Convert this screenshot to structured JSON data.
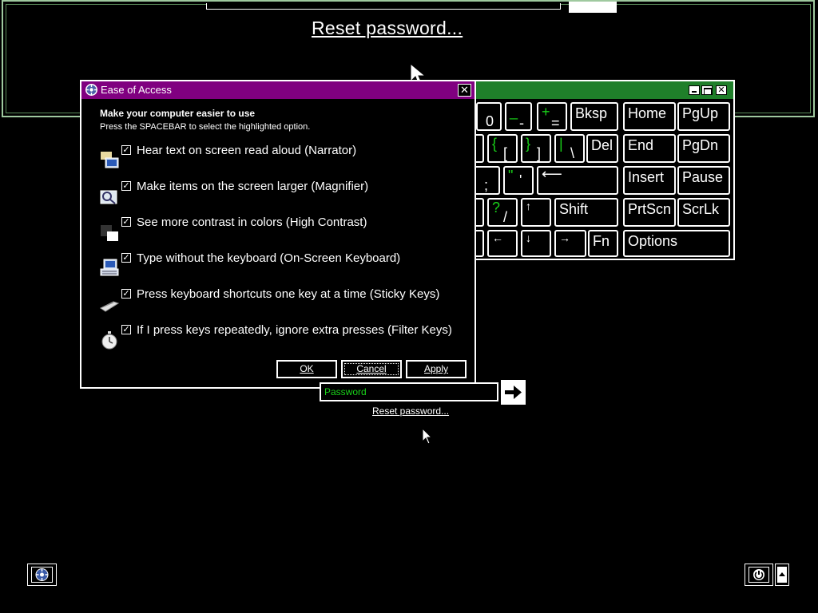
{
  "magnifier": {
    "reset_label": "Reset password..."
  },
  "keyboard": {
    "keys": {
      "zero": "0",
      "minus_top": "_",
      "minus": "-",
      "plus_top": "+",
      "equals": "=",
      "bksp": "Bksp",
      "home": "Home",
      "pgup": "PgUp",
      "brace_l_top": "{",
      "bracket_l": "[",
      "brace_r_top": "}",
      "bracket_r": "]",
      "pipe_top": "|",
      "backslash": "\\",
      "del": "Del",
      "end": "End",
      "pgdn": "PgDn",
      "semicolon": ";",
      "quote_top": "\"",
      "quote": "'",
      "enter": "⟵",
      "insert": "Insert",
      "pause": "Pause",
      "question_top": "?",
      "slash": "/",
      "up": "↑",
      "shift": "Shift",
      "prtscn": "PrtScn",
      "scrlk": "ScrLk",
      "left": "←",
      "down": "↓",
      "right": "→",
      "fn": "Fn",
      "options": "Options"
    }
  },
  "dialog": {
    "title": "Ease of Access",
    "close": "✕",
    "heading": "Make your computer easier to use",
    "subtitle": "Press the SPACEBAR to select the highlighted option.",
    "options": [
      {
        "label": "Hear text on screen read aloud (Narrator)",
        "checked": "✓",
        "icon": "narrator-icon"
      },
      {
        "label": "Make items on the screen larger (Magnifier)",
        "checked": "✓",
        "icon": "magnifier-icon"
      },
      {
        "label": "See more contrast in colors (High Contrast)",
        "checked": "✓",
        "icon": "high-contrast-icon"
      },
      {
        "label": "Type without the keyboard (On-Screen Keyboard)",
        "checked": "✓",
        "icon": "keyboard-icon"
      },
      {
        "label": "Press keyboard shortcuts one key at a time (Sticky Keys)",
        "checked": "✓",
        "icon": "sticky-keys-icon"
      },
      {
        "label": "If I press keys repeatedly, ignore extra presses (Filter Keys)",
        "checked": "✓",
        "icon": "filter-keys-icon"
      }
    ],
    "ok": "OK",
    "cancel": "Cancel",
    "apply": "Apply"
  },
  "login": {
    "password_placeholder": "Password",
    "reset_link": "Reset password..."
  },
  "colors": {
    "dialog_title": "#800080",
    "keyboard_title": "#1f7f2a",
    "accent_green": "#19d119"
  }
}
